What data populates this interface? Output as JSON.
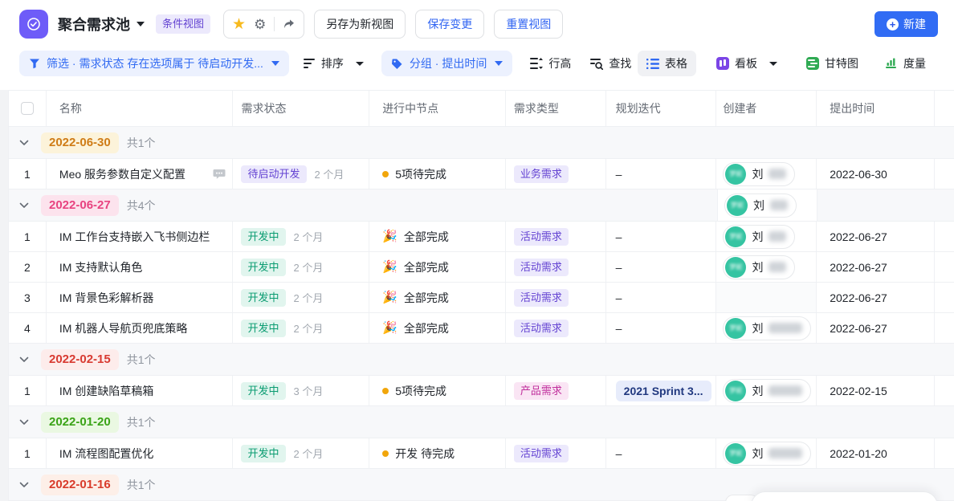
{
  "topbar": {
    "title": "聚合需求池",
    "view_badge": "条件视图",
    "save_as": "另存为新视图",
    "save": "保存变更",
    "reset": "重置视图",
    "create": "新建"
  },
  "icons": {
    "star": "★",
    "gear": "⚙",
    "party": "🎉",
    "plus": "+"
  },
  "toolbar": {
    "filter": "筛选 · 需求状态 存在选项属于 待启动开发...",
    "sort": "排序",
    "group": "分组 · 提出时间",
    "row_height": "行高",
    "find": "查找",
    "views": [
      {
        "id": "table",
        "label": "表格",
        "active": true
      },
      {
        "id": "kanban",
        "label": "看板",
        "active": false
      },
      {
        "id": "gantt",
        "label": "甘特图",
        "active": false
      },
      {
        "id": "measure",
        "label": "度量",
        "active": false
      }
    ]
  },
  "table": {
    "columns": [
      "名称",
      "需求状态",
      "进行中节点",
      "需求类型",
      "规划迭代",
      "创建者",
      "提出时间"
    ],
    "creator_name": "刘",
    "groups": [
      {
        "date": "2022-06-30",
        "count": "共1个",
        "color": "amber",
        "header_creator": false,
        "rows": [
          {
            "num": "1",
            "name": "Meo 服务参数自定义配置",
            "comment": true,
            "status": {
              "label": "待启动开发",
              "color": "purple"
            },
            "duration": "2 个月",
            "node": {
              "icon": "dot",
              "text": "5项待完成"
            },
            "type": {
              "label": "业务需求",
              "color": "purple"
            },
            "sprint": {
              "text": "–"
            },
            "creator": {
              "pill": true,
              "blob": "narrow"
            },
            "date": "2022-06-30"
          }
        ]
      },
      {
        "date": "2022-06-27",
        "count": "共4个",
        "color": "pink",
        "header_creator": true,
        "rows": [
          {
            "num": "1",
            "name": "IM 工作台支持嵌入飞书侧边栏",
            "status": {
              "label": "开发中",
              "color": "teal"
            },
            "duration": "2 个月",
            "node": {
              "icon": "party",
              "text": "全部完成"
            },
            "type": {
              "label": "活动需求",
              "color": "purple"
            },
            "sprint": {
              "text": "–"
            },
            "creator": {
              "pill": true,
              "blob": "narrow"
            },
            "date": "2022-06-27"
          },
          {
            "num": "2",
            "name": "IM 支持默认角色",
            "status": {
              "label": "开发中",
              "color": "teal"
            },
            "duration": "2 个月",
            "node": {
              "icon": "party",
              "text": "全部完成"
            },
            "type": {
              "label": "活动需求",
              "color": "purple"
            },
            "sprint": {
              "text": "–"
            },
            "creator": {
              "pill": true,
              "blob": "narrow"
            },
            "date": "2022-06-27"
          },
          {
            "num": "3",
            "name": "IM 背景色彩解析器",
            "status": {
              "label": "开发中",
              "color": "teal"
            },
            "duration": "2 个月",
            "node": {
              "icon": "party",
              "text": "全部完成"
            },
            "type": {
              "label": "活动需求",
              "color": "purple"
            },
            "sprint": {
              "text": "–"
            },
            "creator": {
              "pill": false,
              "gray": true
            },
            "date": "2022-06-27"
          },
          {
            "num": "4",
            "name": "IM 机器人导航页兜底策略",
            "status": {
              "label": "开发中",
              "color": "teal"
            },
            "duration": "2 个月",
            "node": {
              "icon": "party",
              "text": "全部完成"
            },
            "type": {
              "label": "活动需求",
              "color": "purple"
            },
            "sprint": {
              "text": "–"
            },
            "creator": {
              "pill": true,
              "blob": "wide"
            },
            "date": "2022-06-27"
          }
        ]
      },
      {
        "date": "2022-02-15",
        "count": "共1个",
        "color": "red",
        "header_creator": false,
        "rows": [
          {
            "num": "1",
            "name": "IM 创建缺陷草稿箱",
            "status": {
              "label": "开发中",
              "color": "teal"
            },
            "duration": "3 个月",
            "node": {
              "icon": "dot",
              "text": "5项待完成"
            },
            "type": {
              "label": "产品需求",
              "color": "magenta"
            },
            "sprint": {
              "badge": "2021 Sprint 3..."
            },
            "creator": {
              "pill": true,
              "blob": "wide"
            },
            "date": "2022-02-15"
          }
        ]
      },
      {
        "date": "2022-01-20",
        "count": "共1个",
        "color": "green",
        "header_creator": false,
        "rows": [
          {
            "num": "1",
            "name": "IM 流程图配置优化",
            "status": {
              "label": "开发中",
              "color": "teal"
            },
            "duration": "2 个月",
            "node": {
              "icon": "dot",
              "text": "开发 待完成"
            },
            "type": {
              "label": "活动需求",
              "color": "purple"
            },
            "sprint": {
              "text": "–"
            },
            "creator": {
              "pill": true,
              "blob": "wide"
            },
            "date": "2022-01-20"
          }
        ]
      },
      {
        "date": "2022-01-16",
        "count": "共1个",
        "color": "orangered",
        "header_creator": false,
        "partial_row": true,
        "rows": []
      }
    ]
  }
}
